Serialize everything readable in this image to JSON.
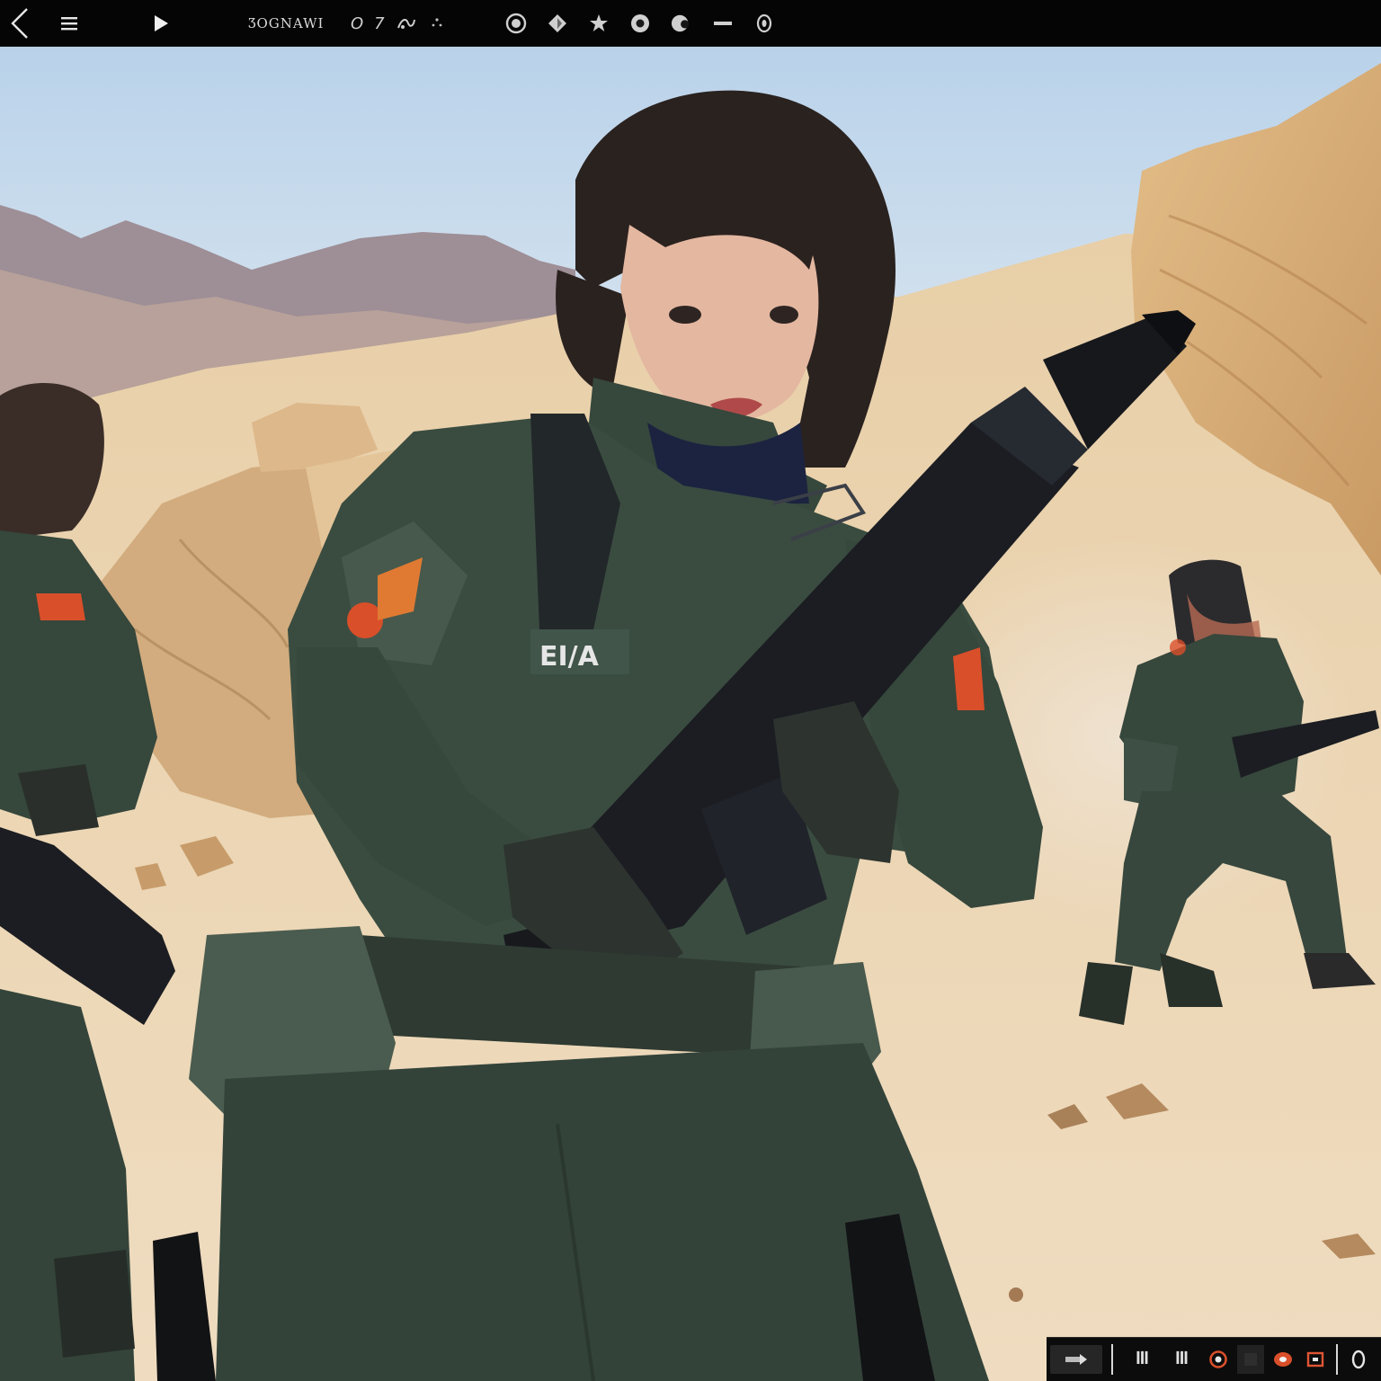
{
  "toolbar": {
    "title": "ƷOGNAWI",
    "glyph_1": "O",
    "glyph_2": "7",
    "icons": [
      "back-icon",
      "menu-icon",
      "play-icon",
      "record-icon",
      "shape-icon",
      "star-icon",
      "circle-icon",
      "mask-icon",
      "dash-icon",
      "target-icon"
    ]
  },
  "canvas": {
    "patch_text": "EI/A",
    "colors": {
      "sky": "#c3d8ec",
      "sand": "#e5c9a2",
      "rock": "#d6ae7c",
      "uniform": "#36473c",
      "weapon": "#1b1d22",
      "accent": "#d94f2a"
    }
  },
  "bottombar": {
    "label_a": "ꟾꟾꟾ",
    "label_b": "ꟾꟾꟾ",
    "icons": [
      "flag-icon",
      "grid-icon",
      "grid-icon",
      "record-icon",
      "square-icon",
      "record-icon",
      "box-icon",
      "circle-icon"
    ]
  }
}
